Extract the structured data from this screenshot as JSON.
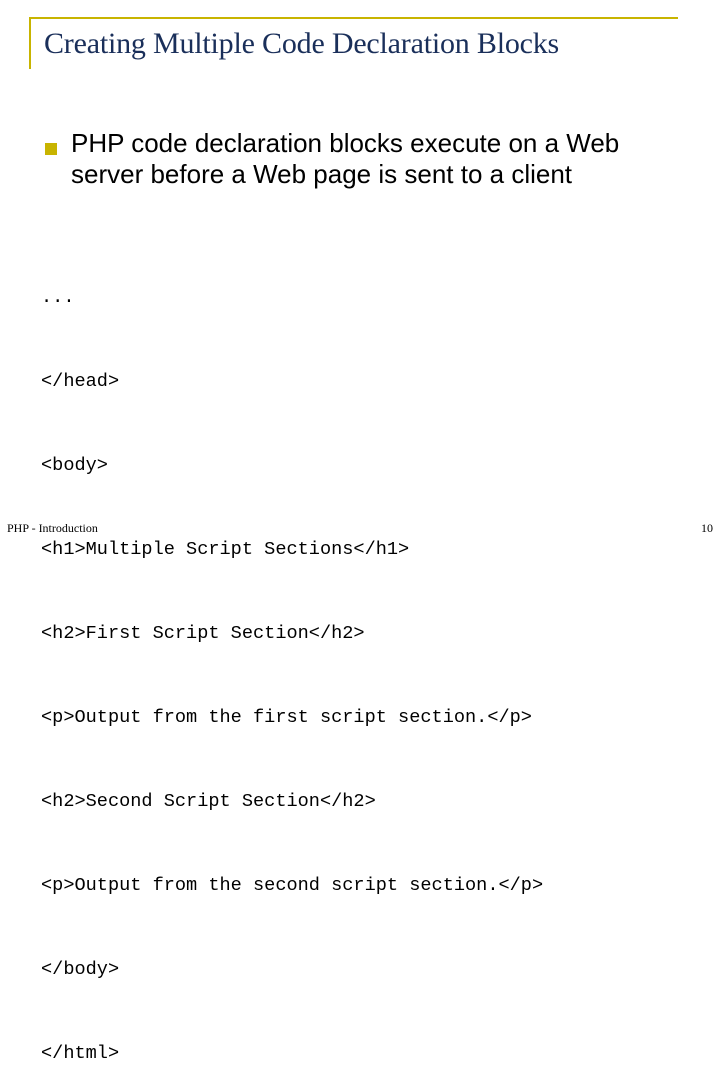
{
  "slide": {
    "title": "Creating Multiple Code Declaration Blocks",
    "bullet": {
      "text": "PHP code declaration blocks execute on a Web server before a Web page is sent to a client"
    },
    "code_lines": [
      "...",
      "</head>",
      "<body>",
      "<h1>Multiple Script Sections</h1>",
      "<h2>First Script Section</h2>",
      "<p>Output from the first script section.</p>",
      "<h2>Second Script Section</h2>",
      "<p>Output from the second script section.</p>",
      "</body>",
      "</html>"
    ],
    "footer": {
      "left": "PHP - Introduction",
      "page_number": "10"
    }
  },
  "colors": {
    "title": "#1a2f5a",
    "accent": "#c8b400",
    "text": "#000000",
    "background": "#ffffff"
  }
}
